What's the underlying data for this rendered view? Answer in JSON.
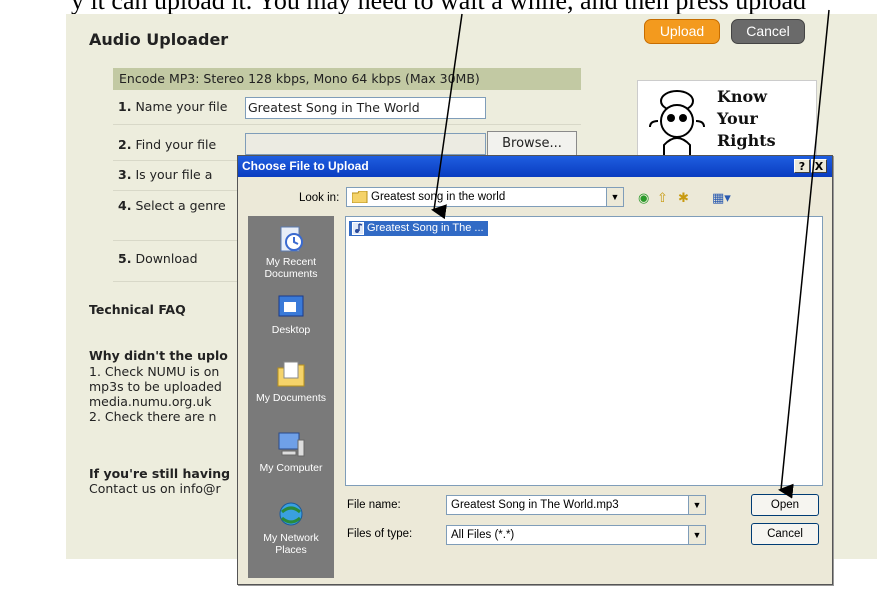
{
  "caption": "y it can upload it. You may need to wait a while, and then press upload",
  "page": {
    "title": "Audio Uploader",
    "upload_label": "Upload",
    "cancel_label": "Cancel",
    "encode_note": "Encode MP3: Stereo 128 kbps, Mono 64 kbps (Max 30MB)",
    "steps": [
      {
        "num": "1.",
        "label": "Name your file"
      },
      {
        "num": "2.",
        "label": "Find your file"
      },
      {
        "num": "3.",
        "label": "Is your file a"
      },
      {
        "num": "4.",
        "label": "Select a genre"
      },
      {
        "num": "5.",
        "label": "Download"
      }
    ],
    "name_value": "Greatest Song in The World",
    "browse_label": "Browse...",
    "faq_heading": "Technical FAQ",
    "faq_q1": "Why didn't the uplo",
    "faq_lines": [
      "1. Check NUMU is on",
      "mp3s to be uploaded",
      "media.numu.org.uk",
      "2. Check there are n"
    ],
    "faq_q2": "If you're still having",
    "faq_contact": "Contact us on info@r",
    "rights_lines": [
      "Know",
      "Your",
      "Rights"
    ]
  },
  "dialog": {
    "title": "Choose File to Upload",
    "help_btn": "?",
    "close_btn": "X",
    "lookin_label": "Look in:",
    "lookin_value": "Greatest song in the world",
    "places": [
      "My Recent Documents",
      "Desktop",
      "My Documents",
      "My Computer",
      "My Network Places"
    ],
    "file_item": "Greatest Song in The ...",
    "filename_label": "File name:",
    "filename_value": "Greatest Song in The World.mp3",
    "filetype_label": "Files of type:",
    "filetype_value": "All Files (*.*)",
    "open_label": "Open",
    "cancel_label": "Cancel"
  }
}
